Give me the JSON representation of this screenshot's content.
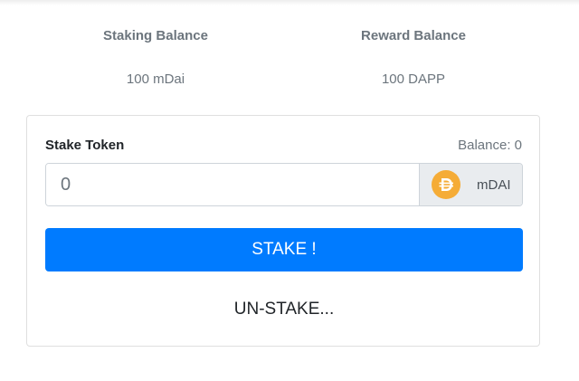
{
  "balances": {
    "staking": {
      "label": "Staking Balance",
      "value": "100 mDai"
    },
    "reward": {
      "label": "Reward Balance",
      "value": "100 DAPP"
    }
  },
  "stake_form": {
    "label": "Stake Token",
    "balance_text": "Balance: 0",
    "amount_placeholder": "0",
    "token_symbol": "mDAI",
    "token_icon": "dai-coin-icon",
    "stake_button": "STAKE !",
    "unstake_button": "UN-STAKE..."
  },
  "colors": {
    "primary": "#007bff",
    "dai_gold": "#F5AC37",
    "muted_text": "#6c757d"
  }
}
